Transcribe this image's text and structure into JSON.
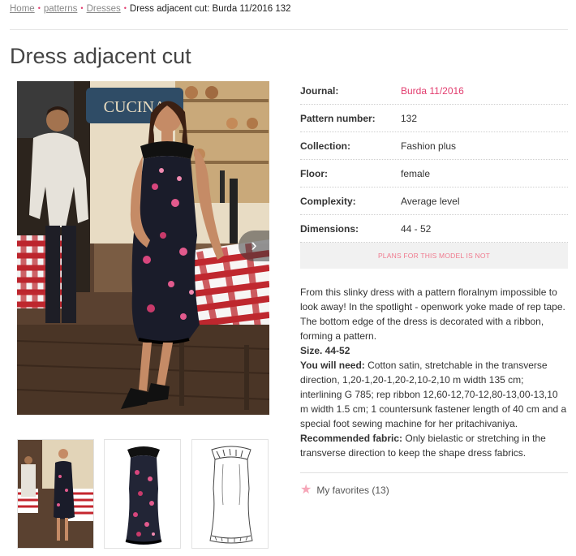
{
  "breadcrumb": {
    "items": [
      "Home",
      "patterns",
      "Dresses"
    ],
    "current": "Dress adjacent cut: Burda 11/2016 132"
  },
  "title": "Dress adjacent cut",
  "gallery": {
    "photo_sign": "CUCINA",
    "next_icon": "chevron-right-icon"
  },
  "properties": [
    {
      "label": "Journal:",
      "value": "Burda 11/2016"
    },
    {
      "label": "Pattern number:",
      "value": "132"
    },
    {
      "label": "Collection:",
      "value": "Fashion plus"
    },
    {
      "label": "Floor:",
      "value": "female"
    },
    {
      "label": "Complexity:",
      "value": "Average level"
    },
    {
      "label": "Dimensions:",
      "value": "44 - 52"
    }
  ],
  "plans_notice": "PLANS FOR THIS MODEL IS NOT",
  "description": {
    "intro": "From this slinky dress with a pattern floralnym impossible to look away! In the spotlight - openwork yoke made of rep tape. The bottom edge of the dress is decorated with a ribbon, forming a pattern.",
    "size_label": "Size. 44-52",
    "need_label": "You will need:",
    "need_text": " Cotton satin, stretchable in the transverse direction, 1,20-1,20-1,20-2,10-2,10 m width 135 cm; interlining G 785; rep ribbon 12,60-12,70-12,80-13,00-13,10 m width 1.5 cm; 1 countersunk fastener length of 40 cm and a special foot sewing machine for her pritachivaniya.",
    "fabric_label": "Recommended fabric:",
    "fabric_text": " Only bielastic or stretching in the transverse direction to keep the shape dress fabrics."
  },
  "favorites": {
    "label": "My favorites (13)",
    "icon": "star-icon"
  },
  "colors": {
    "accent": "#e23c6e",
    "notice_text": "#f07a8e",
    "star": "#f6a6b8"
  }
}
